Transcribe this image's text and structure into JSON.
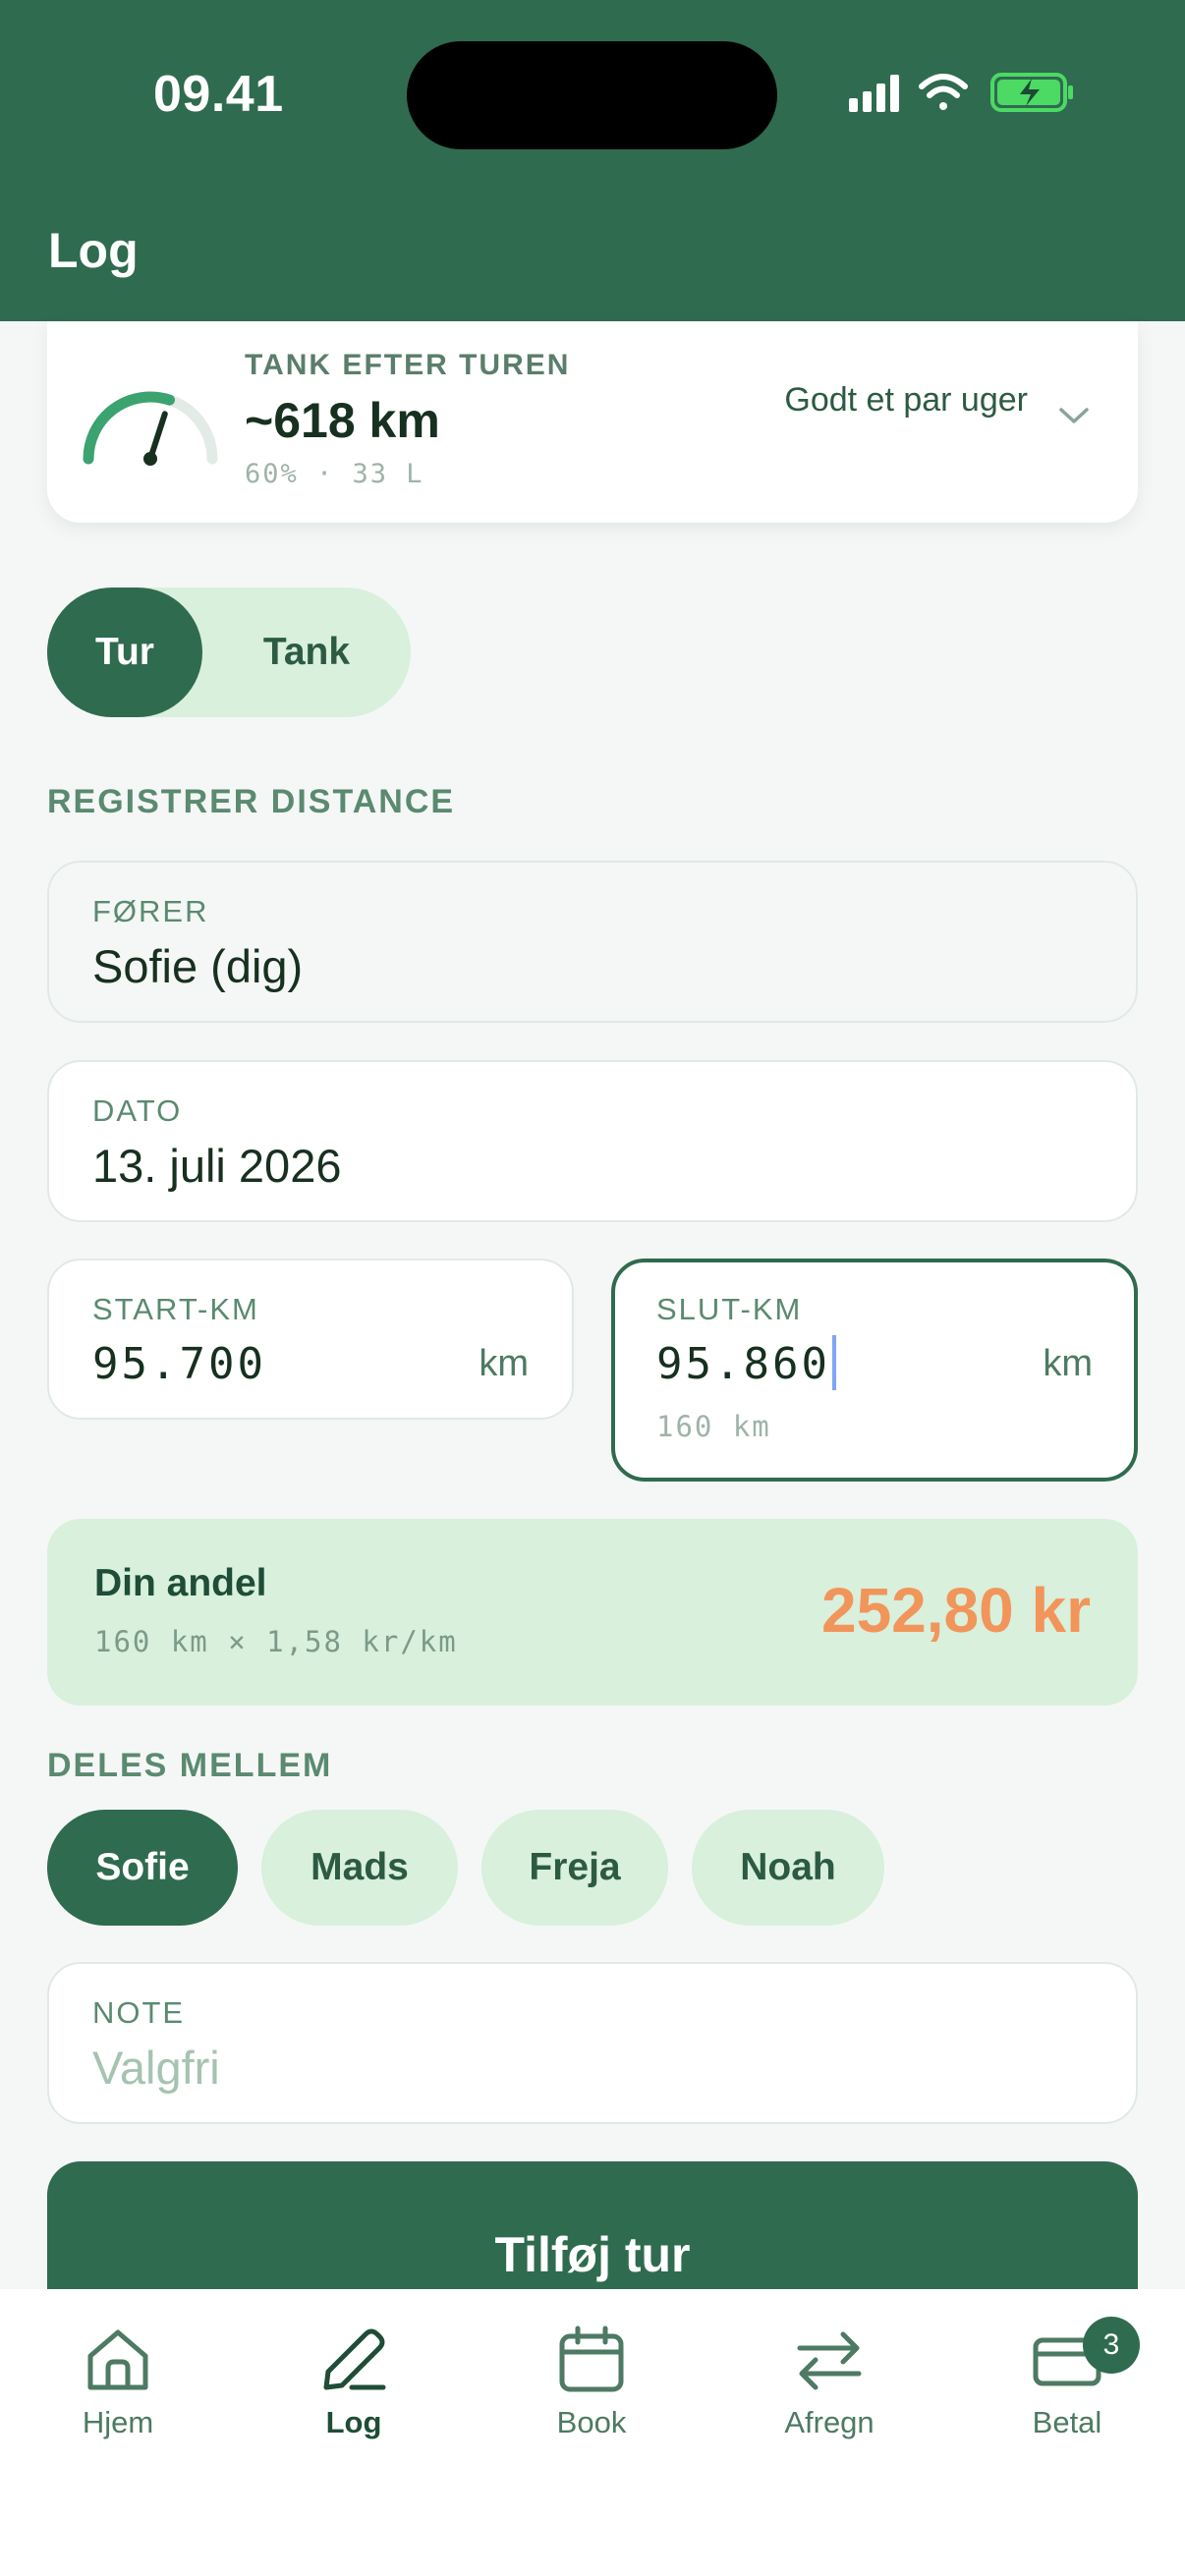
{
  "status_bar": {
    "time": "09.41"
  },
  "header": {
    "title": "Log"
  },
  "tank_card": {
    "label": "TANK EFTER TUREN",
    "range": "~618 km",
    "detail": "60% · 33 L",
    "duration": "Godt et par uger",
    "fuel_level": 0.6
  },
  "mode_toggle": {
    "options": [
      "Tur",
      "Tank"
    ],
    "selected": "Tur"
  },
  "register_section": {
    "label": "REGISTRER DISTANCE"
  },
  "fields": {
    "driver": {
      "label": "FØRER",
      "value": "Sofie (dig)"
    },
    "date": {
      "label": "DATO",
      "value": "13. juli 2026"
    },
    "start_km": {
      "label": "START-KM",
      "value": "95.700",
      "unit": "km"
    },
    "end_km": {
      "label": "SLUT-KM",
      "value": "95.860",
      "unit": "km",
      "hint": "160 km"
    },
    "note": {
      "label": "NOTE",
      "placeholder": "Valgfri"
    }
  },
  "share": {
    "title": "Din andel",
    "formula": "160 km × 1,58 kr/km",
    "amount": "252,80 kr"
  },
  "split_section": {
    "label": "DELES MELLEM",
    "people": [
      "Sofie",
      "Mads",
      "Freja",
      "Noah"
    ],
    "selected": "Sofie"
  },
  "submit": {
    "label": "Tilføj tur"
  },
  "tabbar": {
    "tabs": [
      {
        "label": "Hjem",
        "icon": "home-icon"
      },
      {
        "label": "Log",
        "icon": "pencil-icon",
        "active": true
      },
      {
        "label": "Book",
        "icon": "calendar-icon"
      },
      {
        "label": "Afregn",
        "icon": "swap-arrows-icon"
      },
      {
        "label": "Betal",
        "icon": "card-icon",
        "badge": "3"
      }
    ]
  },
  "colors": {
    "brand": "#2f6b4f",
    "accent_light": "#d8f0dc",
    "amount": "#f2955a",
    "battery": "#4cd964"
  }
}
